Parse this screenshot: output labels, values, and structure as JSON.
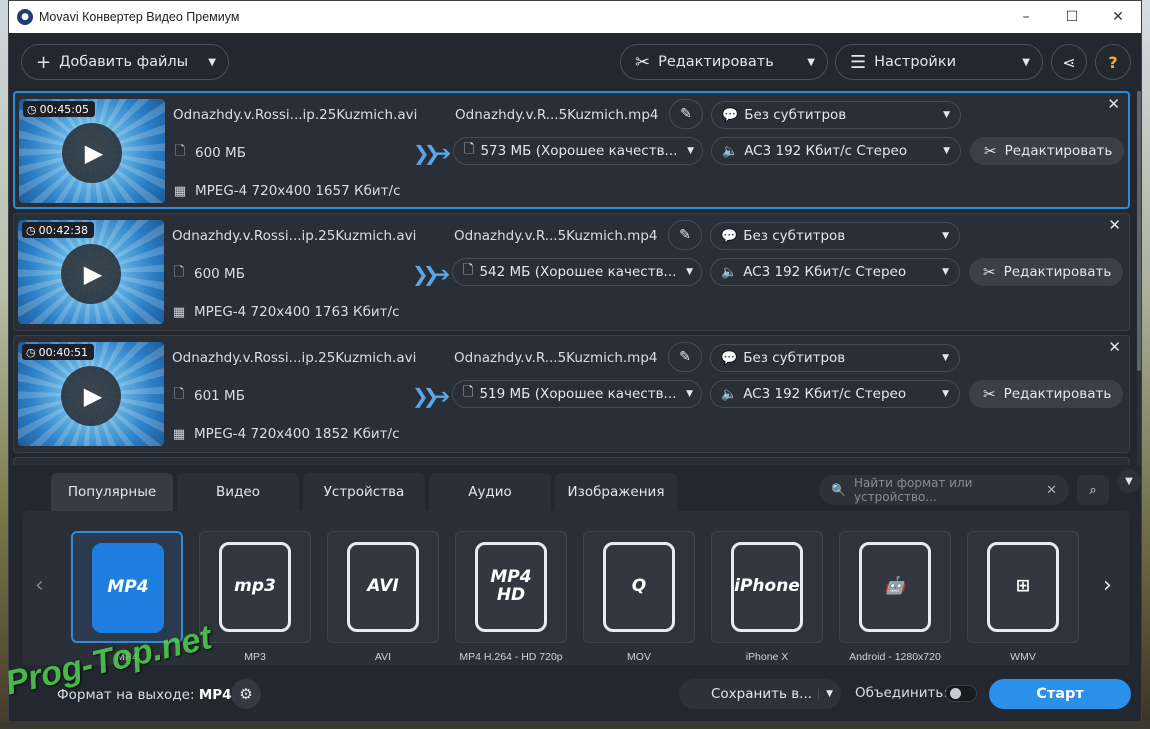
{
  "window": {
    "title": "Movavi Конвертер Видео Премиум",
    "minimize": "–",
    "maximize": "☐",
    "close": "✕"
  },
  "toolbar": {
    "add_files": "Добавить файлы",
    "edit": "Редактировать",
    "settings": "Настройки",
    "share_icon": "share-icon",
    "help": "?"
  },
  "files": [
    {
      "duration": "00:45:05",
      "name": "Odnazhdy.v.Rossi...ip.25Kuzmich.avi",
      "size": "600 МБ",
      "spec": "MPEG-4 720x400 1657 Кбит/с",
      "output_name": "Odnazhdy.v.R...5Kuzmich.mp4",
      "output_size": "573 МБ (Хорошее качеств...",
      "subtitles": "Без субтитров",
      "audio": "AC3 192 Кбит/с Стерео",
      "edit": "Редактировать",
      "selected": true
    },
    {
      "duration": "00:42:38",
      "name": "Odnazhdy.v.Rossi...ip.25Kuzmich.avi",
      "size": "600 МБ",
      "spec": "MPEG-4 720x400 1763 Кбит/с",
      "output_name": "Odnazhdy.v.R...5Kuzmich.mp4",
      "output_size": "542 МБ (Хорошее качеств...",
      "subtitles": "Без субтитров",
      "audio": "AC3 192 Кбит/с Стерео",
      "edit": "Редактировать",
      "selected": false
    },
    {
      "duration": "00:40:51",
      "name": "Odnazhdy.v.Rossi...ip.25Kuzmich.avi",
      "size": "601 МБ",
      "spec": "MPEG-4 720x400 1852 Кбит/с",
      "output_name": "Odnazhdy.v.R...5Kuzmich.mp4",
      "output_size": "519 МБ (Хорошее качеств...",
      "subtitles": "Без субтитров",
      "audio": "AC3 192 Кбит/с Стерео",
      "edit": "Редактировать",
      "selected": false
    }
  ],
  "tabs": [
    "Популярные",
    "Видео",
    "Устройства",
    "Аудио",
    "Изображения"
  ],
  "active_tab": "Популярные",
  "search": {
    "placeholder": "Найти формат или устройство..."
  },
  "formats": [
    {
      "icon_text": "MP4",
      "label": "MP4",
      "selected": true
    },
    {
      "icon_text": "mp3",
      "label": "MP3",
      "selected": false
    },
    {
      "icon_text": "AVI",
      "label": "AVI",
      "selected": false
    },
    {
      "icon_text": "MP4 HD",
      "label": "MP4 H.264 - HD 720p",
      "selected": false
    },
    {
      "icon_text": "Q",
      "label": "MOV",
      "selected": false
    },
    {
      "icon_text": "iPhone",
      "label": "iPhone X",
      "selected": false
    },
    {
      "icon_text": "🤖",
      "label": "Android - 1280x720",
      "selected": false
    },
    {
      "icon_text": "⊞",
      "label": "WMV",
      "selected": false
    }
  ],
  "footer": {
    "output_label": "Формат на выходе:",
    "output_value": "MP4",
    "save": "Сохранить в...",
    "merge": "Объединить:",
    "start": "Старт"
  },
  "watermark": "Prog-Top.net",
  "colors": {
    "accent": "#2a90ea",
    "window_bg": "#23272f",
    "row_bg": "#2a2e36"
  }
}
